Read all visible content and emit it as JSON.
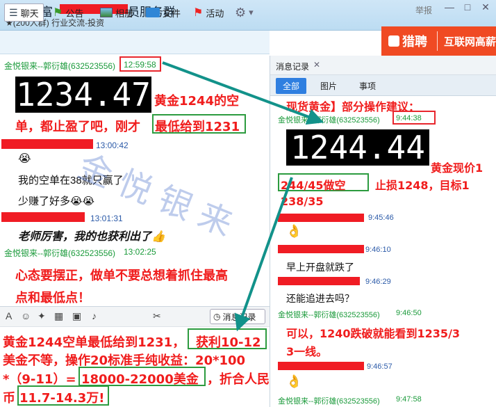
{
  "window": {
    "title": "嘉禄财富",
    "subtitle": "★(200人群) 行业交流-投资",
    "report_label": "举报",
    "minimize": "—",
    "maximize": "□",
    "close": "✕"
  },
  "toolbar": {
    "chat": "聊天",
    "announce": "公告",
    "album": "相册",
    "files": "文件",
    "activity": "活动",
    "settings_arrow": "▾"
  },
  "ad": {
    "brand": "猎聘",
    "text": "互联网高薪"
  },
  "chat": {
    "msg1_sender": "金悦银来--郭衍雄(632523556)",
    "msg1_time": "12:59:58",
    "price1": "1234.47",
    "analysis1_line1": "黄金1244的空",
    "analysis1_line2a": "单，都止盈了吧，刚才",
    "analysis1_line2b": "最低给到1231",
    "msg2_time": "13:00:42",
    "msg2_emoji": "😭",
    "msg2_line1": "我的空单在38就只赢了",
    "msg2_line2": "少赚了好多😭😭",
    "msg3_time": "13:01:31",
    "msg3_text": "老师厉害，我的也获利出了👍",
    "msg4_sender": "金悦银来--郭衍雄(632523556)",
    "msg4_time": "13:02:25",
    "msg4_line1": "心态要摆正，做单不要总想着抓住最高",
    "msg4_line2": "点和最低点！"
  },
  "inputbar": {
    "history_label": "消息记录"
  },
  "summary": {
    "l1a": "黄金1244空单最低给到1231，",
    "l1b": "获利10-12",
    "l2": "美金不等，操作20标准手纯收益：20*100",
    "l3a": "*（9-11）=",
    "l3b": "18000-22000美金",
    "l3c": "，折合人民",
    "l4a": "币",
    "l4b": "11.7-14.3万!"
  },
  "right": {
    "header": "消息记录",
    "close": "✕",
    "tabs": [
      "全部",
      "图片",
      "事项"
    ],
    "headline": "现货黄金】部分操作建议：",
    "m1_sender": "金悦银来--郭衍雄(632523556)",
    "m1_time": "9:44:38",
    "price2": "1244.44",
    "a1": "黄金现价1",
    "a2a": "244/45做空",
    "a2b": "止损1248，目标1",
    "a3": "238/35",
    "m2_time": "9:45:46",
    "m2_emoji": "👌",
    "m3_time": "9:46:10",
    "m3_text": "早上开盘就跌了",
    "m4_time": "9:46:29",
    "m4_text": "还能追进去吗？",
    "m5_sender": "金悦银来--郭衍雄(632523556)",
    "m5_time": "9:46:50",
    "m5_line1": "可以，1240跌破就能看到1235/3",
    "m5_line2": "3一线。",
    "m6_time": "9:46:57",
    "m6_emoji": "👌",
    "m7_sender": "金悦银来--郭衍雄(632523556)",
    "m7_time": "9:47:58"
  },
  "watermark": "金悦银来",
  "colors": {
    "arrow": "#12928a",
    "red": "#f01c1c",
    "green_box": "#2c9b3f",
    "red_box": "#e8262d",
    "sender_green": "#1a9a3a"
  }
}
